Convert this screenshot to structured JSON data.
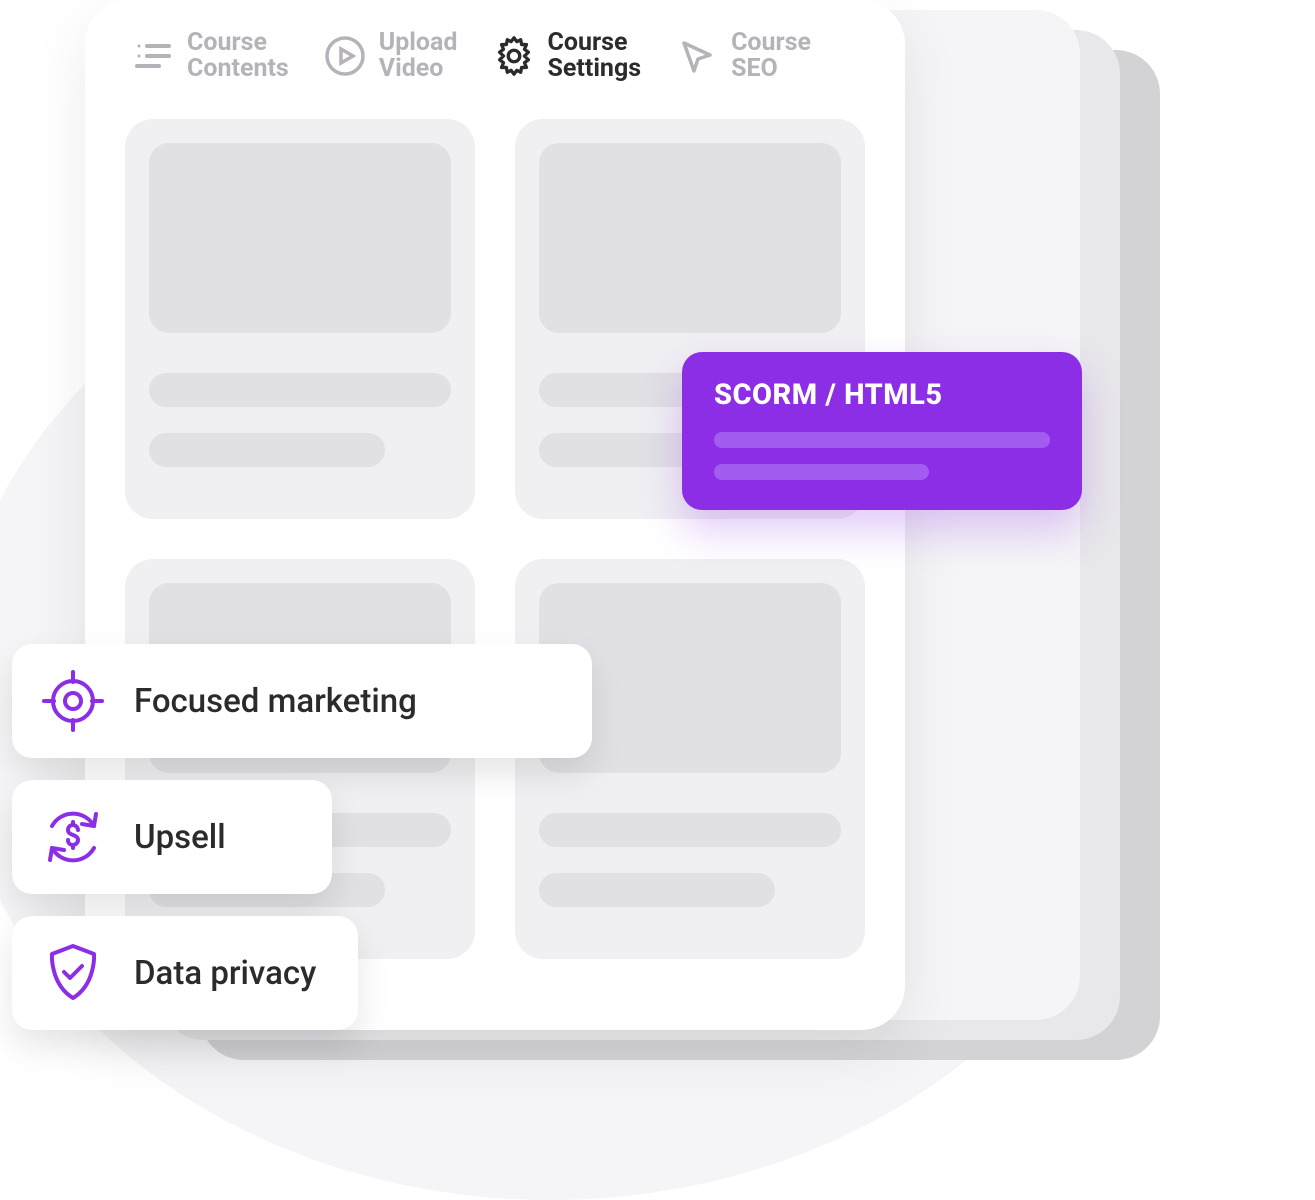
{
  "colors": {
    "accent_purple": "#8b2ee6",
    "text_inactive": "#b5b3b9",
    "text_active": "#2b2b2b",
    "panel_bg": "#ffffff",
    "card_bg": "#f0eff2",
    "placeholder": "#e1e0e4"
  },
  "tabs": [
    {
      "label": "Course\nContents",
      "icon": "list-icon",
      "active": false
    },
    {
      "label": "Upload\nVideo",
      "icon": "play-circle-icon",
      "active": false
    },
    {
      "label": "Course\nSettings",
      "icon": "gear-icon",
      "active": true
    },
    {
      "label": "Course\nSEO",
      "icon": "cursor-icon",
      "active": false
    }
  ],
  "badge": {
    "title": "SCORM / HTML5"
  },
  "chips": [
    {
      "label": "Focused marketing",
      "icon": "target-icon"
    },
    {
      "label": "Upsell",
      "icon": "refresh-dollar-icon"
    },
    {
      "label": "Data privacy",
      "icon": "shield-check-icon"
    }
  ]
}
